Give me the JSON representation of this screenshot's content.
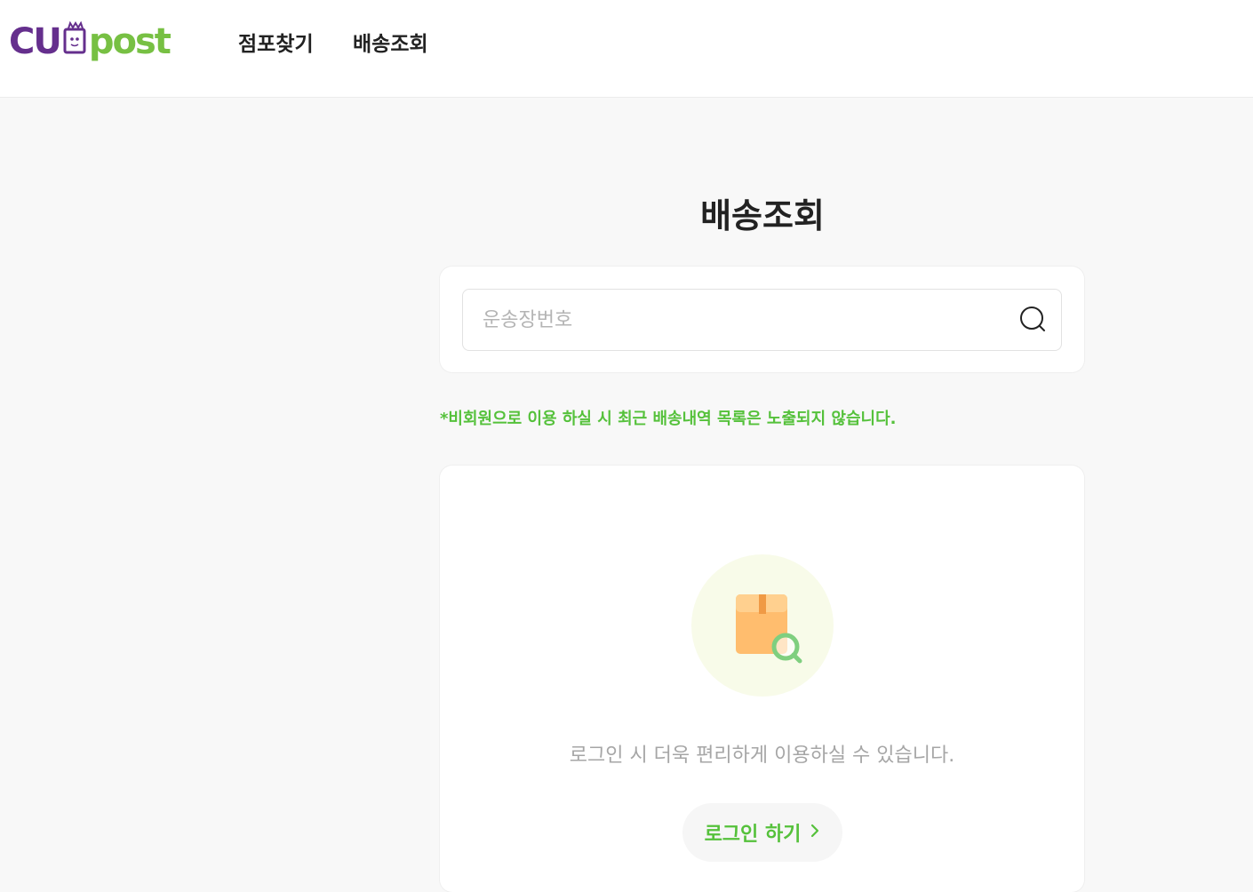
{
  "header": {
    "logo": {
      "part1": "CU",
      "part2": "post"
    },
    "nav": [
      {
        "label": "점포찾기"
      },
      {
        "label": "배송조회"
      }
    ]
  },
  "main": {
    "title": "배송조회",
    "search": {
      "placeholder": "운송장번호",
      "value": ""
    },
    "notice": "*비회원으로 이용 하실 시 최근 배송내역 목록은 노출되지 않습니다.",
    "login_message": "로그인 시 더욱 편리하게 이용하실 수 있습니다.",
    "login_button": "로그인 하기"
  },
  "colors": {
    "brand_purple": "#652f8d",
    "brand_green": "#77c043",
    "accent_green": "#55c13b",
    "background": "#f8f8f8"
  },
  "icons": {
    "search": "search-icon",
    "package": "package-search-icon",
    "chevron": "chevron-right-icon",
    "logo_bag": "shopping-bag-icon"
  }
}
